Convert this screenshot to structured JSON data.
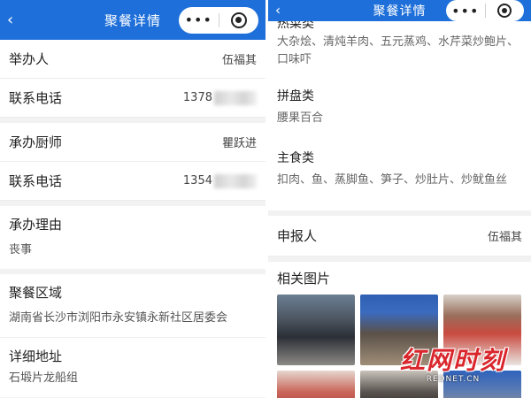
{
  "nav": {
    "back_icon": "chevron-left-icon",
    "title": "聚餐详情",
    "more_label": "•••"
  },
  "colors": {
    "nav_bg": "#1e6fd9",
    "watermark": "#d9262c"
  },
  "left": {
    "organizer": {
      "label": "举办人",
      "value": "伍福其"
    },
    "organizer_phone": {
      "label": "联系电话",
      "value": "1378"
    },
    "chef": {
      "label": "承办厨师",
      "value": "瞿跃进"
    },
    "chef_phone": {
      "label": "联系电话",
      "value": "1354"
    },
    "reason": {
      "label": "承办理由",
      "value": "丧事"
    },
    "area": {
      "label": "聚餐区域",
      "value": "湖南省长沙市浏阳市永安镇永新社区居委会"
    },
    "address": {
      "label": "详细地址",
      "value": "石塅片龙船组"
    }
  },
  "right": {
    "partial_category": "热菜类",
    "hot_dishes": "大杂烩、清炖羊肉、五元蒸鸡、水芹菜炒鲍片、口味吓",
    "platter": {
      "label": "拼盘类",
      "value": "腰果百合"
    },
    "staple": {
      "label": "主食类",
      "value": "扣肉、鱼、蒸脚鱼、笋子、炒肚片、炒鱿鱼丝"
    },
    "reporter": {
      "label": "申报人",
      "value": "伍福其"
    },
    "photos_label": "相关图片"
  },
  "watermark": {
    "main": "红网时刻",
    "sub": "REDNET.CN"
  }
}
